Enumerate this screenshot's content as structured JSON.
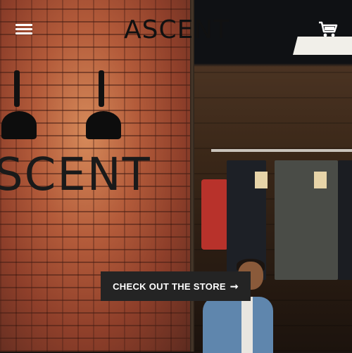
{
  "header": {
    "menu_icon": "hamburger-menu-icon",
    "logo_text": "ASCENT",
    "cart_icon": "shopping-cart-icon"
  },
  "hero": {
    "wall_sign_text": "SCENT",
    "cta_label": "CHECK OUT THE STORE",
    "cta_arrow": "➞"
  },
  "colors": {
    "cta_background": "#242424",
    "cta_text": "#ffffff",
    "logo": "#111111"
  }
}
